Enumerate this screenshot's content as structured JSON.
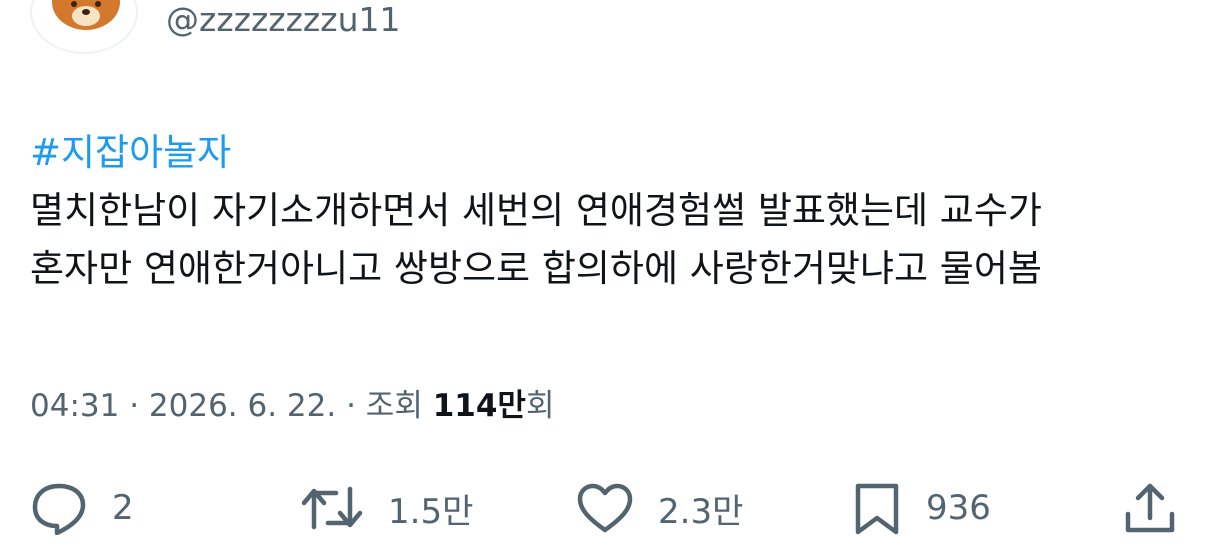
{
  "author": {
    "handle": "@zzzzzzzzu11",
    "avatar_icon": "bear-avatar-icon"
  },
  "tweet": {
    "hashtag": "#지잡아놀자",
    "lines": [
      "멸치한남이 자기소개하면서 세번의 연애경험썰 발표했는데 교수가",
      "혼자만 연애한거아니고 쌍방으로 합의하에 사랑한거맞냐고 물어봄"
    ]
  },
  "meta": {
    "datetime": "04:31 · 2026. 6. 22. · 조회",
    "views_count": "114만",
    "views_suffix": "회"
  },
  "actions": {
    "reply": {
      "icon": "reply-bubble-icon",
      "count": "2"
    },
    "retweet": {
      "icon": "retweet-icon",
      "count": "1.5만"
    },
    "like": {
      "icon": "heart-icon",
      "count": "2.3만"
    },
    "bookmark": {
      "icon": "bookmark-icon",
      "count": "936"
    },
    "share": {
      "icon": "share-icon"
    }
  },
  "colors": {
    "text": "#0f1419",
    "muted": "#536471",
    "hashtag": "#1d9bf0",
    "avatar_bear": "#c9702a"
  }
}
